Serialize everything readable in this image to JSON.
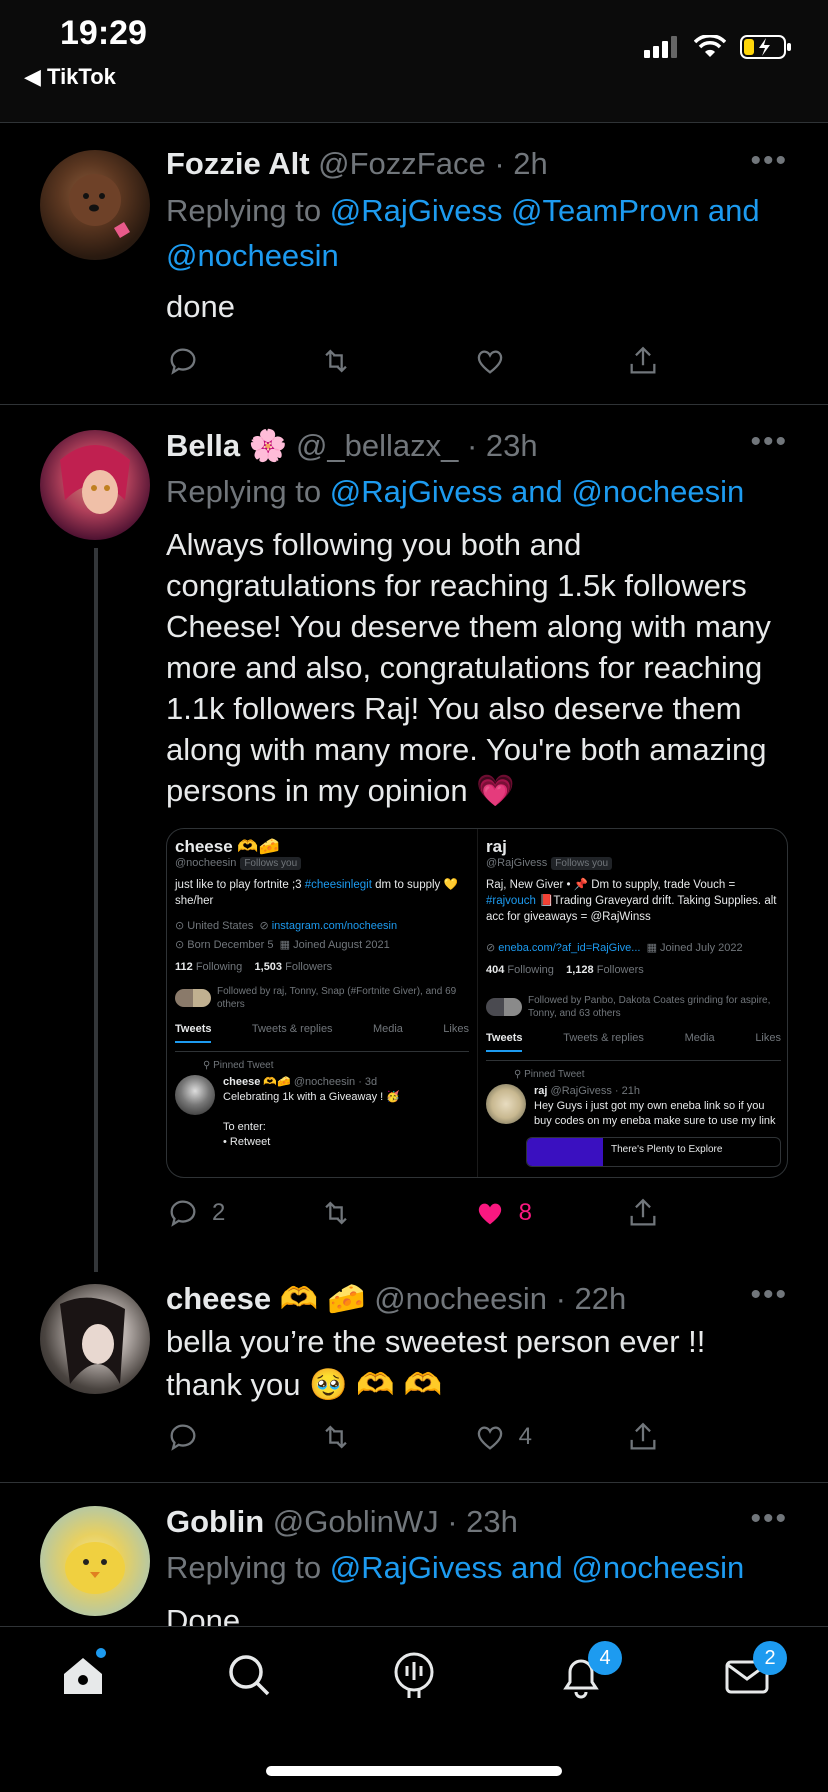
{
  "status_bar": {
    "time": "19:29",
    "back_label": "◀ TikTok"
  },
  "tweets": [
    {
      "name": "Fozzie Alt",
      "handle": "@FozzFace · 2h",
      "replying_prefix": "Replying to ",
      "replying_links": "@RajGivess @TeamProvn and @nocheesin",
      "text": "done"
    },
    {
      "name": "Bella 🌸",
      "handle": "@_bellazx_ · 23h",
      "replying_prefix": "Replying to ",
      "replying_links": "@RajGivess and @nocheesin",
      "text": "Always following you both and congratulations for reaching 1.5k followers Cheese! You deserve them along with many more and also, congratulations for reaching 1.1k followers Raj! You also deserve them along with many more. You're both amazing persons in my opinion 💗",
      "reply_count": "2",
      "like_count": "8"
    },
    {
      "name": "cheese 🫶 🧀",
      "handle": "@nocheesin · 22h",
      "text": "bella you’re the sweetest person ever !! thank you 🥹 🫶 🫶",
      "like_count": "4"
    },
    {
      "name": "Goblin",
      "handle": "@GoblinWJ · 23h",
      "replying_prefix": "Replying to ",
      "replying_links": "@RajGivess and @nocheesin",
      "text": "Done"
    }
  ],
  "embed": {
    "left": {
      "name": "cheese 🫶🧀",
      "handle": "@nocheesin",
      "follows_you": "Follows you",
      "bio_prefix": "just like to play fortnite ;3 ",
      "bio_link": "#cheesinlegit",
      "bio_suffix": " dm to supply 💛 she/her",
      "location": "United States",
      "website": "instagram.com/nocheesin",
      "born": "Born December 5",
      "joined": "Joined August 2021",
      "following": "112",
      "following_label": "Following",
      "followers": "1,503",
      "followers_label": "Followers",
      "followed_by": "Followed by raj, Tonny, Snap (#Fortnite Giver), and 69 others",
      "tabs": [
        "Tweets",
        "Tweets & replies",
        "Media",
        "Likes"
      ],
      "pinned_label": "Pinned Tweet",
      "pinned_author": "cheese 🫶🧀",
      "pinned_meta": "@nocheesin · 3d",
      "pinned_text": "Celebrating 1k with a Giveaway ! 🥳",
      "pinned_text2": "To enter:",
      "pinned_text3": "• Retweet"
    },
    "right": {
      "name": "raj",
      "handle": "@RajGivess",
      "follows_you": "Follows you",
      "bio_prefix": "Raj, New Giver • 📌 Dm to supply, trade Vouch = ",
      "bio_link": "#rajvouch",
      "bio_suffix": " 📕Trading Graveyard drift. Taking Supplies. alt acc for giveaways = @RajWinss",
      "website": "eneba.com/?af_id=RajGive...",
      "joined": "Joined July 2022",
      "following": "404",
      "following_label": "Following",
      "followers": "1,128",
      "followers_label": "Followers",
      "followed_by": "Followed by Panbo, Dakota Coates grinding for aspire, Tonny, and 63 others",
      "tabs": [
        "Tweets",
        "Tweets & replies",
        "Media",
        "Likes"
      ],
      "pinned_label": "Pinned Tweet",
      "pinned_author": "raj",
      "pinned_meta": "@RajGivess · 21h",
      "pinned_text": "Hey Guys i just got my own eneba link so if you buy codes on my eneba make sure to use my link",
      "card_text": "There's Plenty to Explore"
    }
  },
  "tab_bar": {
    "notifications_badge": "4",
    "messages_badge": "2"
  },
  "colors": {
    "accent": "#1d9bf0",
    "like": "#f91880",
    "muted": "#71767b"
  }
}
